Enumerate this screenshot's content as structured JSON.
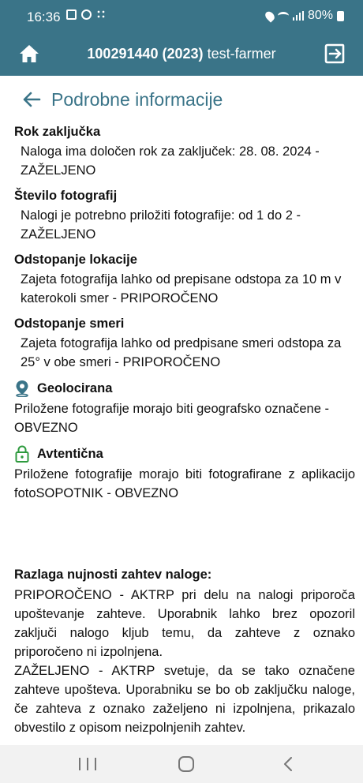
{
  "status_bar": {
    "time": "16:36",
    "battery": "80%"
  },
  "app_bar": {
    "id": "100291440 (2023)",
    "user": "test-farmer"
  },
  "subheader": {
    "title": "Podrobne informacije"
  },
  "sections": {
    "rok": {
      "title": "Rok zaključka",
      "text": "Naloga ima določen rok za zaključek: 28. 08. 2024 - ZAŽELJENO"
    },
    "stevilo": {
      "title": "Število fotografij",
      "text": "Nalogi je potrebno priložiti fotografije: od 1 do 2 - ZAŽELJENO"
    },
    "lokacija": {
      "title": "Odstopanje lokacije",
      "text": "Zajeta fotografija lahko od prepisane odstopa za 10 m v katerokoli smer - PRIPOROČENO"
    },
    "smer": {
      "title": "Odstopanje smeri",
      "text": "Zajeta fotografija lahko od predpisane smeri odstopa za 25° v obe smeri - PRIPOROČENO"
    },
    "geo": {
      "title": "Geolocirana",
      "text": "Priložene fotografije morajo biti geografsko označene - OBVEZNO",
      "icon": "location-pin-icon"
    },
    "avt": {
      "title": "Avtentična",
      "text": "Priložene fotografije morajo biti fotografirane z aplikacijo fotoSOPOTNIK - OBVEZNO",
      "icon": "lock-icon"
    }
  },
  "razlaga": {
    "title": "Razlaga nujnosti zahtev naloge:",
    "p1": "PRIPOROČENO - AKTRP pri delu na nalogi priporoča upoštevanje zahteve. Uporabnik lahko brez opozoril zaključi nalogo kljub temu, da zahteve z oznako priporočeno ni izpolnjena.",
    "p2": "ZAŽELJENO - AKTRP svetuje, da se tako označene zahteve upošteva. Uporabniku se bo ob zaključku naloge, če zahteva z oznako zaželjeno ni izpolnjena, prikazalo obvestilo z opisom neizpolnjenih zahtev."
  },
  "colors": {
    "primary": "#3a7488",
    "accent_green": "#2e9a3e",
    "nav_bg": "#f2f2f2"
  }
}
